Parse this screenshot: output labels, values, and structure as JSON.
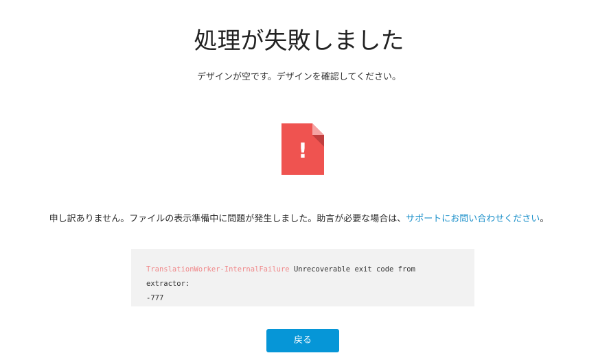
{
  "header": {
    "title": "処理が失敗しました",
    "subtitle": "デザインが空です。デザインを確認してください。"
  },
  "icon": {
    "name": "file-error-icon",
    "color": "#ef5350",
    "fold_color": "#f5a3a3",
    "fold_shadow": "#b83b3b",
    "glyph": "!"
  },
  "message": {
    "text": "申し訳ありません。ファイルの表示準備中に問題が発生しました。助言が必要な場合は、",
    "link_text": "サポートにお問い合わせください",
    "end": "。"
  },
  "error": {
    "name": "TranslationWorker-InternalFailure",
    "detail": " Unrecoverable exit code from extractor:",
    "code": "-777"
  },
  "actions": {
    "back_label": "戻る"
  },
  "colors": {
    "accent": "#0696d7",
    "link": "#1a8fc9",
    "error_name": "#f0888a",
    "code_background": "#f2f2f2"
  }
}
